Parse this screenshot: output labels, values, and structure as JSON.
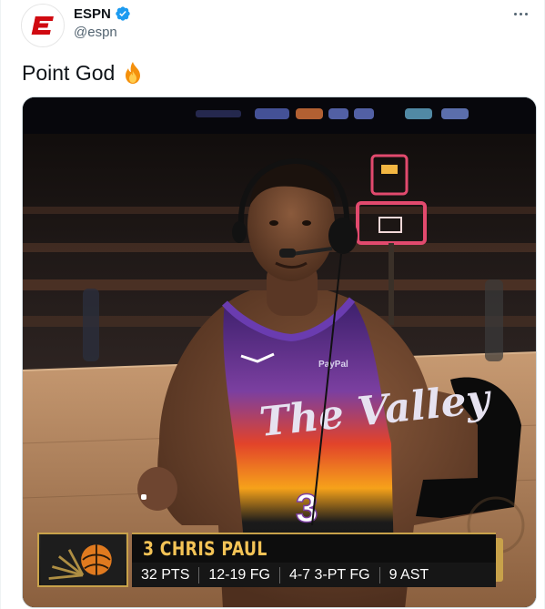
{
  "author": {
    "display_name": "ESPN",
    "handle": "@espn",
    "verified": true,
    "avatar_icon": "espn-logo-icon",
    "brand_color": "#d00a11"
  },
  "tweet": {
    "text": "Point God",
    "emoji_icon": "fire-emoji-icon"
  },
  "media": {
    "jersey_text": "The Valley",
    "jersey_sponsor": "PayPal",
    "jersey_number": "3",
    "lower_third": {
      "player_name": "3 CHRIS PAUL",
      "stats": [
        "32 PTS",
        "12-19 FG",
        "4-7 3-PT FG",
        "9 AST"
      ],
      "team_logo_icon": "suns-logo-icon"
    }
  },
  "colors": {
    "verified_blue": "#1d9bf0",
    "secondary_text": "#536471",
    "gold": "#c8a24a"
  }
}
